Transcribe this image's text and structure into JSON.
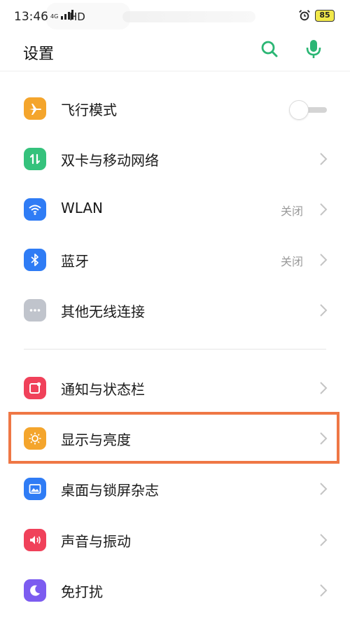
{
  "status_bar": {
    "time": "13:46",
    "network": "4G",
    "hd": "HD",
    "battery": "85",
    "alarm_icon": "alarm-clock-icon"
  },
  "header": {
    "title": "设置",
    "search_icon": "search-icon",
    "mic_icon": "microphone-icon",
    "accent_color": "#2bb674"
  },
  "settings": {
    "items": [
      {
        "label": "飞行模式",
        "icon": "airplane-icon",
        "color": "#f4a52c",
        "control": "toggle",
        "toggle_on": false
      },
      {
        "label": "双卡与移动网络",
        "icon": "dual-sim-icon",
        "color": "#35c27c",
        "control": "chevron"
      },
      {
        "label": "WLAN",
        "icon": "wifi-icon",
        "color": "#2f7cf5",
        "control": "chevron",
        "value": "关闭"
      },
      {
        "label": "蓝牙",
        "icon": "bluetooth-icon",
        "color": "#2f7cf5",
        "control": "chevron",
        "value": "关闭"
      },
      {
        "label": "其他无线连接",
        "icon": "more-dots-icon",
        "color": "#c0c4cc",
        "control": "chevron"
      },
      {
        "label": "通知与状态栏",
        "icon": "notification-icon",
        "color": "#f0415a",
        "control": "chevron"
      },
      {
        "label": "显示与亮度",
        "icon": "brightness-icon",
        "color": "#f4a52c",
        "control": "chevron",
        "highlighted": true
      },
      {
        "label": "桌面与锁屏杂志",
        "icon": "wallpaper-icon",
        "color": "#2f7cf5",
        "control": "chevron"
      },
      {
        "label": "声音与振动",
        "icon": "speaker-icon",
        "color": "#f0415a",
        "control": "chevron"
      },
      {
        "label": "免打扰",
        "icon": "moon-icon",
        "color": "#7c5cf0",
        "control": "chevron"
      }
    ]
  },
  "highlight_color": "#ef7745"
}
